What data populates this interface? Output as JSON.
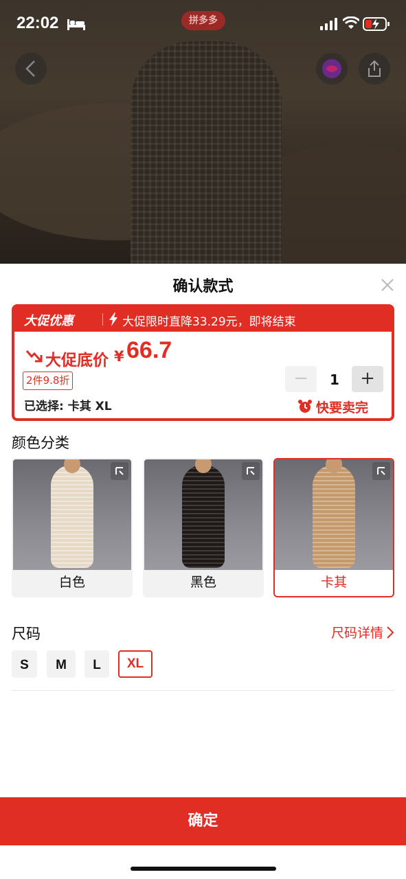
{
  "status_bar": {
    "time": "22:02"
  },
  "app_badge": "拼多多",
  "sheet": {
    "title": "确认款式",
    "promo": {
      "tag": "大促优惠",
      "message": "大促限时直降33.29元，即将结束"
    },
    "price": {
      "label": "大促底价",
      "currency": "¥",
      "value": "66.7"
    },
    "discount_tag": "2件9.8折",
    "selected_text": "已选择: 卡其 XL",
    "quantity": {
      "minus": "−",
      "value": "1",
      "plus": "+"
    },
    "selling_fast": "快要卖完",
    "color_section": {
      "label": "颜色分类",
      "options": [
        {
          "name": "白色",
          "selected": false
        },
        {
          "name": "黑色",
          "selected": false
        },
        {
          "name": "卡其",
          "selected": true
        }
      ]
    },
    "size_section": {
      "label": "尺码",
      "guide_label": "尺码详情",
      "options": [
        "S",
        "M",
        "L",
        "XL"
      ],
      "selected": "XL"
    },
    "confirm_label": "确定"
  },
  "colors": {
    "accent": "#e02e24",
    "chip_bg": "#f2f2f2",
    "dress_white": "#e6d9c6",
    "dress_black": "#1f1a17",
    "dress_khaki": "#c49a6c"
  },
  "icons": [
    "bed-icon",
    "signal-icon",
    "wifi-icon",
    "battery-icon",
    "back-arrow-icon",
    "avatar-icon",
    "share-icon",
    "close-icon",
    "bolt-icon",
    "trend-down-icon",
    "alarm-clock-icon",
    "expand-icon",
    "chevron-right-icon"
  ]
}
